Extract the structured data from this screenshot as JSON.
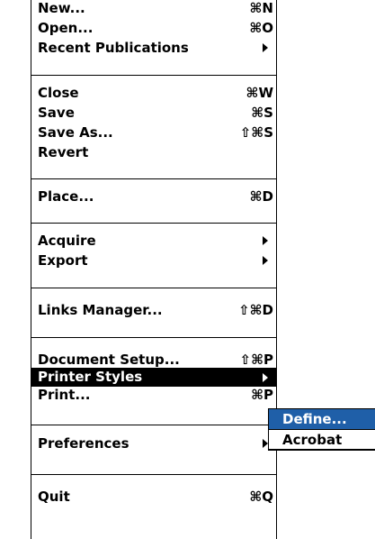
{
  "menu": {
    "items": [
      {
        "label": "New...",
        "shortcut": "⌘N"
      },
      {
        "label": "Open...",
        "shortcut": "⌘O"
      },
      {
        "label": "Recent Publications",
        "shortcut": ""
      },
      {
        "label": "Close",
        "shortcut": "⌘W"
      },
      {
        "label": "Save",
        "shortcut": "⌘S"
      },
      {
        "label": "Save As...",
        "shortcut": "⇧⌘S"
      },
      {
        "label": "Revert",
        "shortcut": ""
      },
      {
        "label": "Place...",
        "shortcut": "⌘D"
      },
      {
        "label": "Acquire",
        "shortcut": ""
      },
      {
        "label": "Export",
        "shortcut": ""
      },
      {
        "label": "Links Manager...",
        "shortcut": "⇧⌘D"
      },
      {
        "label": "Document Setup...",
        "shortcut": "⇧⌘P"
      },
      {
        "label": "Printer Styles",
        "shortcut": ""
      },
      {
        "label": "Print...",
        "shortcut": "⌘P"
      },
      {
        "label": "Preferences",
        "shortcut": ""
      },
      {
        "label": "Quit",
        "shortcut": "⌘Q"
      }
    ],
    "highlighted_item": "Printer Styles"
  },
  "submenu": {
    "items": [
      {
        "label": "Define..."
      },
      {
        "label": "Acrobat"
      }
    ],
    "highlighted_item": "Define..."
  },
  "colors": {
    "submenu_highlight": "#1f5fa8",
    "menu_highlight": "#000000"
  }
}
